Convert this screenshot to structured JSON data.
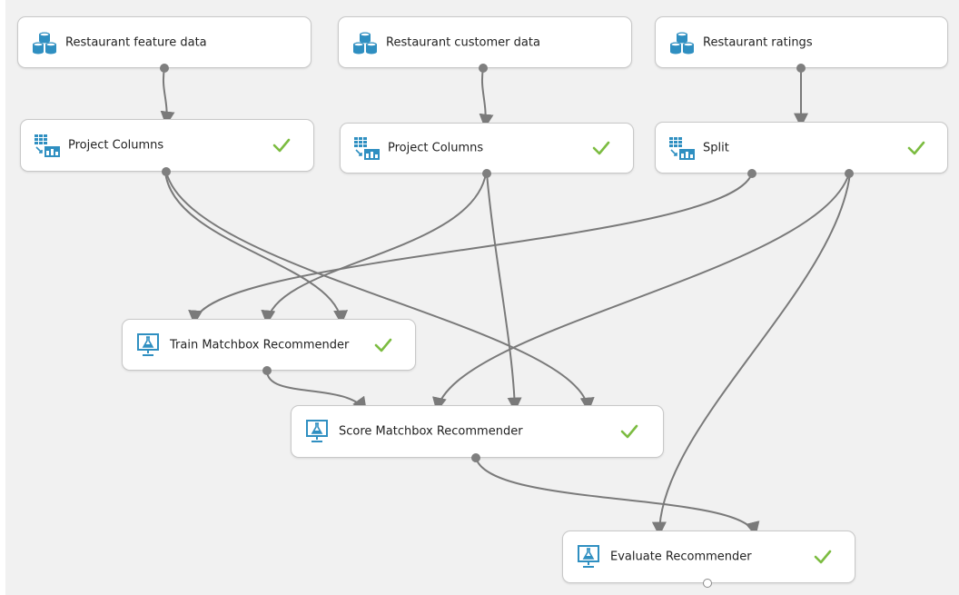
{
  "colors": {
    "canvas": "#f1f1f1",
    "wire": "#7a7a7a",
    "dataset_icon": "#2f8fc1",
    "module_icon": "#2f8fc1",
    "check": "#7cbc41"
  },
  "modules": {
    "restaurant_feature_data": {
      "label": "Restaurant feature data",
      "icon": "dataset-icon",
      "status": ""
    },
    "restaurant_customer_data": {
      "label": "Restaurant customer data",
      "icon": "dataset-icon",
      "status": ""
    },
    "restaurant_ratings": {
      "label": "Restaurant ratings",
      "icon": "dataset-icon",
      "status": ""
    },
    "project_columns_1": {
      "label": "Project Columns",
      "icon": "table-transform-icon",
      "status": "completed"
    },
    "project_columns_2": {
      "label": "Project Columns",
      "icon": "table-transform-icon",
      "status": "completed"
    },
    "split": {
      "label": "Split",
      "icon": "table-transform-icon",
      "status": "completed"
    },
    "train_matchbox_recommender": {
      "label": "Train Matchbox Recommender",
      "icon": "flask-monitor-icon",
      "status": "completed"
    },
    "score_matchbox_recommender": {
      "label": "Score Matchbox Recommender",
      "icon": "flask-monitor-icon",
      "status": "completed"
    },
    "evaluate_recommender": {
      "label": "Evaluate Recommender",
      "icon": "flask-monitor-icon",
      "status": "completed"
    }
  },
  "connections": [
    {
      "from": "restaurant_feature_data",
      "to": "project_columns_1"
    },
    {
      "from": "restaurant_customer_data",
      "to": "project_columns_2"
    },
    {
      "from": "restaurant_ratings",
      "to": "split"
    },
    {
      "from": "split",
      "to": "train_matchbox_recommender"
    },
    {
      "from": "project_columns_2",
      "to": "train_matchbox_recommender"
    },
    {
      "from": "project_columns_1",
      "to": "train_matchbox_recommender"
    },
    {
      "from": "train_matchbox_recommender",
      "to": "score_matchbox_recommender"
    },
    {
      "from": "split",
      "to": "score_matchbox_recommender"
    },
    {
      "from": "project_columns_2",
      "to": "score_matchbox_recommender"
    },
    {
      "from": "project_columns_1",
      "to": "score_matchbox_recommender"
    },
    {
      "from": "score_matchbox_recommender",
      "to": "evaluate_recommender"
    },
    {
      "from": "split",
      "to": "evaluate_recommender"
    }
  ]
}
